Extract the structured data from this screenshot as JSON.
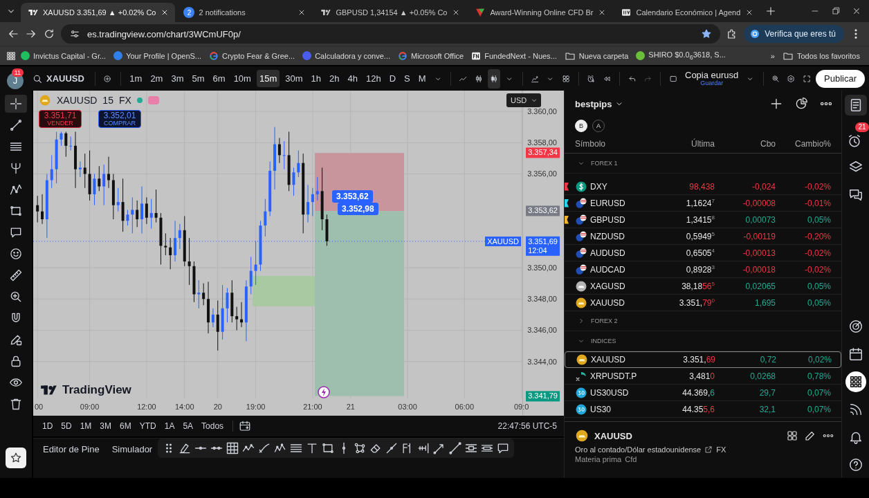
{
  "browser": {
    "tabs": [
      {
        "title": "XAUUSD 3.351,69 ▲ +0.02% Co",
        "selected": true,
        "kind": "tv"
      },
      {
        "title": "2 notifications",
        "selected": false,
        "kind": "badge",
        "badge": "2"
      },
      {
        "title": "GBPUSD 1,34154 ▲ +0.05% Co",
        "selected": false,
        "kind": "tv"
      },
      {
        "title": "Award-Winning Online CFD Br",
        "selected": false,
        "kind": "triangle"
      },
      {
        "title": "Calendario Económico | Agend",
        "selected": false,
        "kind": "box"
      }
    ],
    "url": "es.tradingview.com/chart/3WCmUF0p/",
    "verify_button": "Verifica que eres tú",
    "bookmarks": [
      {
        "label": "Invictus Capital - Gr...",
        "kind": "dot",
        "color": "#1fbf5f"
      },
      {
        "label": "Your Profile | OpenS...",
        "kind": "dot",
        "color": "#2f80ed"
      },
      {
        "label": "Crypto Fear & Gree...",
        "kind": "google"
      },
      {
        "label": "Calculadora y conve...",
        "kind": "dot",
        "color": "#4b5cf0"
      },
      {
        "label": "Microsoft Office",
        "kind": "google"
      },
      {
        "label": "FundedNext - Nues...",
        "kind": "box"
      },
      {
        "label": "Nueva carpeta",
        "kind": "folder"
      },
      {
        "label": "SHIRO $0.0$_{6}$3618, S...",
        "kind": "dot",
        "color": "#6bbf3a"
      }
    ],
    "more": "»",
    "all_bookmarks": "Todos los favoritos"
  },
  "toolbar": {
    "avatar": "J",
    "avatar_badge": "11",
    "symbol": "XAUUSD",
    "intervals": [
      {
        "label": "1m",
        "selected": false
      },
      {
        "label": "2m",
        "selected": false
      },
      {
        "label": "3m",
        "selected": false
      },
      {
        "label": "5m",
        "selected": false
      },
      {
        "label": "6m",
        "selected": false
      },
      {
        "label": "10m",
        "selected": false
      },
      {
        "label": "15m",
        "selected": true
      },
      {
        "label": "30m",
        "selected": false
      },
      {
        "label": "1h",
        "selected": false
      },
      {
        "label": "2h",
        "selected": false
      },
      {
        "label": "4h",
        "selected": false
      },
      {
        "label": "12h",
        "selected": false
      },
      {
        "label": "D",
        "selected": false
      },
      {
        "label": "S",
        "selected": false
      },
      {
        "label": "M",
        "selected": false
      }
    ],
    "layout_name": "Copia eurusd",
    "layout_status": "Guardar",
    "publish_button": "Publicar"
  },
  "left_toolbar": {
    "tools": [
      {
        "kind": "crosshair",
        "selected": true
      },
      {
        "kind": "trend-line",
        "selected": false
      },
      {
        "kind": "lines",
        "selected": false
      },
      {
        "kind": "pitchfork",
        "selected": false
      },
      {
        "kind": "pattern",
        "selected": false
      },
      {
        "kind": "rectangle",
        "selected": false
      },
      {
        "kind": "comment",
        "selected": false
      },
      {
        "kind": "smiley",
        "selected": false
      },
      {
        "kind": "ruler",
        "selected": false
      },
      {
        "kind": "zoom",
        "selected": false
      },
      {
        "kind": "magnet",
        "selected": false
      },
      {
        "kind": "pencil-lock",
        "selected": false
      },
      {
        "kind": "lock",
        "selected": false
      },
      {
        "kind": "eye",
        "selected": false
      },
      {
        "kind": "trash",
        "selected": false
      }
    ]
  },
  "chart": {
    "legend": {
      "symbol": "XAUUSD",
      "interval": "15",
      "exchange": "FX"
    },
    "sell": {
      "price": "3.351,71",
      "label": "VENDER"
    },
    "buy": {
      "price": "3.352,01",
      "label": "COMPRAR"
    },
    "currency": "USD",
    "chart_data": {
      "type": "candlestick",
      "categories": [
        "00",
        null,
        null,
        null,
        null,
        null,
        null,
        null,
        null,
        null,
        null,
        "09:00",
        null,
        null,
        null,
        null,
        null,
        null,
        null,
        null,
        null,
        null,
        null,
        "12:00",
        null,
        null,
        null,
        null,
        null,
        null,
        null,
        "14:00",
        null,
        null,
        null,
        null,
        null,
        null,
        "20",
        null,
        null,
        null,
        null,
        null,
        null,
        null,
        "19:00",
        null,
        null,
        null,
        null,
        null,
        null,
        null,
        null,
        null,
        null,
        null,
        "21:00",
        null,
        null,
        null,
        null,
        null,
        null,
        null,
        "21",
        null,
        null,
        null,
        null,
        null,
        null,
        null,
        null,
        null,
        null,
        null,
        "03:00",
        null,
        null,
        null,
        null,
        null,
        null,
        null,
        null,
        null,
        null,
        null,
        "06:00",
        null,
        null,
        null,
        null,
        null,
        null,
        null,
        null,
        null,
        null,
        null,
        "09:0"
      ],
      "ohlc": [
        [
          3354.0,
          3354.6,
          3352.9,
          3353.6
        ],
        [
          3353.6,
          3354.7,
          3352.8,
          3353.1
        ],
        [
          3353.1,
          3356.0,
          3351.9,
          3355.6
        ],
        [
          3355.6,
          3357.2,
          3355.1,
          3356.3
        ],
        [
          3356.3,
          3358.7,
          3355.4,
          3358.2
        ],
        [
          3358.2,
          3358.7,
          3357.8,
          3358.6
        ],
        [
          3358.6,
          3358.7,
          3357.1,
          3357.8
        ],
        [
          3357.8,
          3358.4,
          3357.5,
          3357.8
        ],
        [
          3357.8,
          3358.7,
          3355.1,
          3356.3
        ],
        [
          3356.3,
          3356.8,
          3355.8,
          3356.4
        ],
        [
          3356.4,
          3357.3,
          3355.1,
          3356.0
        ],
        [
          3356.0,
          3357.5,
          3354.3,
          3354.7
        ],
        [
          3354.7,
          3356.0,
          3354.0,
          3355.7
        ],
        [
          3355.7,
          3356.5,
          3354.9,
          3355.2
        ],
        [
          3355.2,
          3356.6,
          3354.0,
          3356.0
        ],
        [
          3356.0,
          3357.1,
          3355.1,
          3355.6
        ],
        [
          3355.6,
          3356.0,
          3353.1,
          3354.0
        ],
        [
          3354.0,
          3355.1,
          3353.6,
          3354.2
        ],
        [
          3354.2,
          3355.7,
          3352.3,
          3353.0
        ],
        [
          3353.0,
          3353.7,
          3352.7,
          3353.4
        ],
        [
          3353.4,
          3354.5,
          3352.2,
          3353.7
        ],
        [
          3353.7,
          3354.3,
          3352.6,
          3353.1
        ],
        [
          3353.1,
          3355.2,
          3352.2,
          3354.1
        ],
        [
          3354.1,
          3354.5,
          3352.8,
          3353.2
        ],
        [
          3353.2,
          3354.4,
          3352.5,
          3353.5
        ],
        [
          3353.5,
          3355.0,
          3352.9,
          3353.2
        ],
        [
          3353.2,
          3353.5,
          3350.2,
          3351.4
        ],
        [
          3351.4,
          3352.2,
          3350.8,
          3351.3
        ],
        [
          3351.3,
          3351.9,
          3349.9,
          3350.8
        ],
        [
          3350.8,
          3353.0,
          3350.4,
          3351.9
        ],
        [
          3351.9,
          3352.8,
          3351.2,
          3352.4
        ],
        [
          3352.4,
          3353.3,
          3350.1,
          3350.4
        ],
        [
          3350.4,
          3351.9,
          3348.9,
          3350.1
        ],
        [
          3350.1,
          3350.4,
          3347.8,
          3348.3
        ],
        [
          3348.3,
          3349.2,
          3347.4,
          3348.4
        ],
        [
          3348.4,
          3349.0,
          3347.6,
          3348.0
        ],
        [
          3348.0,
          3349.1,
          3345.8,
          3346.5
        ],
        [
          3346.5,
          3347.4,
          3346.2,
          3347.0
        ],
        [
          3347.0,
          3347.9,
          3344.7,
          3345.9
        ],
        [
          3345.9,
          3348.9,
          3345.4,
          3347.4
        ],
        [
          3347.4,
          3348.7,
          3346.5,
          3348.4
        ],
        [
          3348.4,
          3349.2,
          3346.5,
          3346.9
        ],
        [
          3346.9,
          3347.5,
          3346.0,
          3346.7
        ],
        [
          3346.7,
          3347.8,
          3346.2,
          3346.5
        ],
        [
          3346.5,
          3349.2,
          3345.3,
          3348.8
        ],
        [
          3348.8,
          3350.7,
          3348.3,
          3349.8
        ],
        [
          3349.8,
          3351.7,
          3348.9,
          3350.2
        ],
        [
          3350.2,
          3353.0,
          3349.8,
          3352.7
        ],
        [
          3352.7,
          3354.4,
          3352.0,
          3353.6
        ],
        [
          3353.6,
          3356.8,
          3353.3,
          3356.2
        ],
        [
          3356.2,
          3359.0,
          3355.0,
          3357.9
        ],
        [
          3357.9,
          3358.3,
          3356.7,
          3357.2
        ],
        [
          3357.2,
          3358.1,
          3356.3,
          3357.2
        ],
        [
          3357.2,
          3358.7,
          3354.9,
          3355.3
        ],
        [
          3355.3,
          3356.4,
          3354.6,
          3356.1
        ],
        [
          3356.1,
          3357.5,
          3355.8,
          3356.7
        ],
        [
          3356.7,
          3357.3,
          3352.2,
          3353.4
        ],
        [
          3353.4,
          3355.3,
          3352.9,
          3354.2
        ],
        [
          3354.2,
          3355.1,
          3353.3,
          3354.7
        ],
        [
          3354.7,
          3355.8,
          3354.3,
          3354.9
        ],
        [
          3354.9,
          3356.4,
          3352.4,
          3353.1
        ],
        [
          3353.1,
          3353.4,
          3351.4,
          3351.69
        ],
        null,
        null,
        null,
        null,
        null,
        null,
        null,
        null,
        null,
        null,
        null,
        null,
        null,
        null,
        null,
        null,
        null,
        null,
        null,
        null,
        null,
        null,
        null,
        null,
        null,
        null,
        null,
        null,
        null,
        null,
        null,
        null,
        null,
        null,
        null,
        null,
        null,
        null,
        null,
        null,
        null
      ],
      "ylim": [
        3341.64,
        3361.33
      ],
      "grid": true,
      "ref_lines": [
        {
          "axis": "y",
          "value": 3351.69,
          "color": "#2962ff"
        }
      ],
      "yticks": [
        {
          "value": 3360,
          "label": "3.360,00"
        },
        {
          "value": 3358,
          "label": "3.358,00"
        },
        {
          "value": 3356,
          "label": "3.356,00"
        },
        {
          "value": 3350,
          "label": "3.350,00"
        },
        {
          "value": 3348,
          "label": "3.348,00"
        },
        {
          "value": 3346,
          "label": "3.346,00"
        },
        {
          "value": 3344,
          "label": "3.344,00"
        }
      ]
    },
    "price_tags": [
      {
        "kind": "stop",
        "text": "3.357,34"
      },
      {
        "kind": "entry",
        "text": "3.353,62"
      },
      {
        "kind": "last",
        "text": "3.351,69",
        "countdown": "12:04",
        "symbol": "XAUUSD"
      },
      {
        "kind": "target",
        "text": "3.341,79"
      }
    ],
    "position_labels": [
      "3.353,62",
      "3.352,98"
    ],
    "logo_text": "TradingView"
  },
  "date_bar": {
    "ranges": [
      "1D",
      "5D",
      "1M",
      "3M",
      "6M",
      "YTD",
      "1A",
      "5A",
      "Todos"
    ],
    "clock": "22:47:56 UTC-5"
  },
  "bottom_panel": {
    "tabs": [
      "Editor de Pine",
      "Simulador"
    ]
  },
  "watchlist": {
    "title": "bestpips",
    "views": [
      {
        "label": "B",
        "selected": true
      },
      {
        "label": "A",
        "selected": false
      }
    ],
    "columns": [
      "Símbolo",
      "Última",
      "Cbo",
      "Cambio%"
    ],
    "groups": [
      {
        "name": "FOREX 1",
        "expanded": true,
        "rows": [
          {
            "symbol": "DXY",
            "kind": "dollar",
            "color": "#f23645",
            "last": {
              "highlight": "98,438"
            },
            "tick_down": true,
            "change": "-0,024",
            "percent": "-0,02%",
            "negative": true,
            "selected": false
          },
          {
            "symbol": "EURUSD",
            "kind": "flags",
            "color": "#22d3ee",
            "last": {
              "base": "1,1624",
              "pip": "7"
            },
            "change": "-0,00008",
            "percent": "-0,01%",
            "negative": true,
            "selected": false
          },
          {
            "symbol": "GBPUSD",
            "kind": "flags",
            "color": "#f5b52e",
            "last": {
              "base": "1,3415",
              "pip": "8"
            },
            "change": "0,00073",
            "percent": "0,05%",
            "negative": false,
            "selected": false
          },
          {
            "symbol": "NZDUSD",
            "kind": "flags",
            "last": {
              "base": "0,5949",
              "pip": "5"
            },
            "change": "-0,00119",
            "percent": "-0,20%",
            "negative": true,
            "selected": false
          },
          {
            "symbol": "AUDUSD",
            "kind": "flags",
            "last": {
              "base": "0,6505",
              "pip": "4"
            },
            "change": "-0,00013",
            "percent": "-0,02%",
            "negative": true,
            "selected": false
          },
          {
            "symbol": "AUDCAD",
            "kind": "flags",
            "last": {
              "base": "0,8928",
              "pip": "3"
            },
            "change": "-0,00018",
            "percent": "-0,02%",
            "negative": true,
            "selected": false
          },
          {
            "symbol": "XAGUSD",
            "kind": "silver",
            "last": {
              "base": "38,18",
              "highlight": "56",
              "pip": "5"
            },
            "tick_down": true,
            "change": "0,02065",
            "percent": "0,05%",
            "negative": false,
            "selected": false
          },
          {
            "symbol": "XAUUSD",
            "kind": "gold",
            "last": {
              "base": "3.351,",
              "highlight": "79",
              "pip": "0"
            },
            "tick_down": true,
            "change": "1,695",
            "percent": "0,05%",
            "negative": false,
            "selected": false
          }
        ]
      },
      {
        "name": "FOREX 2",
        "expanded": false
      },
      {
        "name": "INDICES",
        "expanded": true,
        "rows": [
          {
            "symbol": "XAUUSD",
            "kind": "gold",
            "last": {
              "base": "3.351,",
              "highlight": "69"
            },
            "tick_down": true,
            "change": "0,72",
            "percent": "0,02%",
            "negative": false,
            "selected": true
          },
          {
            "symbol": "XRPUSDT.P",
            "kind": "crypto",
            "last": {
              "base": "3,481",
              "highlight": "0"
            },
            "tick_down": true,
            "change": "0,0268",
            "percent": "0,78%",
            "negative": false,
            "selected": false
          },
          {
            "symbol": "US30USD",
            "kind": "index",
            "last": {
              "base": "44.369,",
              "highlight": "6"
            },
            "tick_down": false,
            "change": "29,7",
            "percent": "0,07%",
            "negative": false,
            "selected": false
          },
          {
            "symbol": "US30",
            "kind": "index",
            "last": {
              "base": "44.35",
              "highlight": "5,6"
            },
            "tick_down": true,
            "change": "32,1",
            "percent": "0,07%",
            "negative": false,
            "selected": false
          }
        ]
      }
    ],
    "detail": {
      "symbol": "XAUUSD",
      "description": "Oro al contado/Dólar estadounidense",
      "exchange": "FX",
      "category": "Materia prima",
      "type": "Cfd"
    }
  },
  "right_bar": {
    "alerts_badge": "21"
  }
}
